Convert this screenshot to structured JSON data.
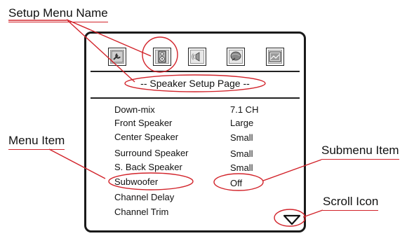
{
  "callouts": {
    "setup_menu_name": "Setup Menu Name",
    "menu_item": "Menu Item",
    "submenu_item": "Submenu Item",
    "scroll_icon": "Scroll Icon"
  },
  "screen": {
    "page_title": "-- Speaker Setup Page --",
    "tab_icons": [
      "wrench-icon",
      "speaker-icon",
      "sound-icon",
      "disc-icon",
      "picture-icon"
    ],
    "selected_tab": "speaker-icon",
    "rows": [
      {
        "label": "Down-mix",
        "value": "7.1 CH"
      },
      {
        "label": "Front Speaker",
        "value": "Large"
      },
      {
        "label": "Center Speaker",
        "value": "Small"
      },
      {
        "label": "Surround Speaker",
        "value": "Small"
      },
      {
        "label": "S. Back Speaker",
        "value": "Small"
      },
      {
        "label": "Subwoofer",
        "value": "Off"
      },
      {
        "label": "Channel Delay",
        "value": ""
      },
      {
        "label": "Channel Trim",
        "value": ""
      }
    ],
    "scroll_icon": "triangle-down-icon"
  },
  "colors": {
    "callout_red": "#d2232a",
    "frame": "#1a1a1a"
  }
}
